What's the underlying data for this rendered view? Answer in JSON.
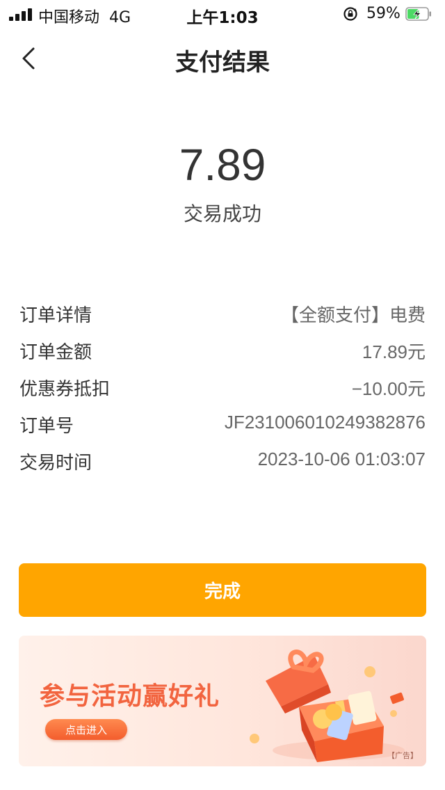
{
  "status_bar": {
    "carrier": "中国移动",
    "network": "4G",
    "time": "上午1:03",
    "battery_percent": "59%",
    "battery_level": 0.59,
    "battery_color": "#4cd964"
  },
  "header": {
    "back_icon": "chevron-left-icon",
    "title": "支付结果"
  },
  "payment": {
    "amount": "7.89",
    "status": "交易成功"
  },
  "details": [
    {
      "label": "订单详情",
      "value": "【全额支付】电费"
    },
    {
      "label": "订单金额",
      "value": "17.89元"
    },
    {
      "label": "优惠券抵扣",
      "value": "−10.00元"
    },
    {
      "label": "订单号",
      "value": "JF231006010249382876"
    },
    {
      "label": "交易时间",
      "value": "2023-10-06 01:03:07"
    }
  ],
  "done_button": {
    "label": "完成",
    "color": "#ffa500"
  },
  "banner": {
    "title": "参与活动赢好礼",
    "cta": "点击进入",
    "ad_tag": "【广告】",
    "accent_color": "#f2643f"
  }
}
